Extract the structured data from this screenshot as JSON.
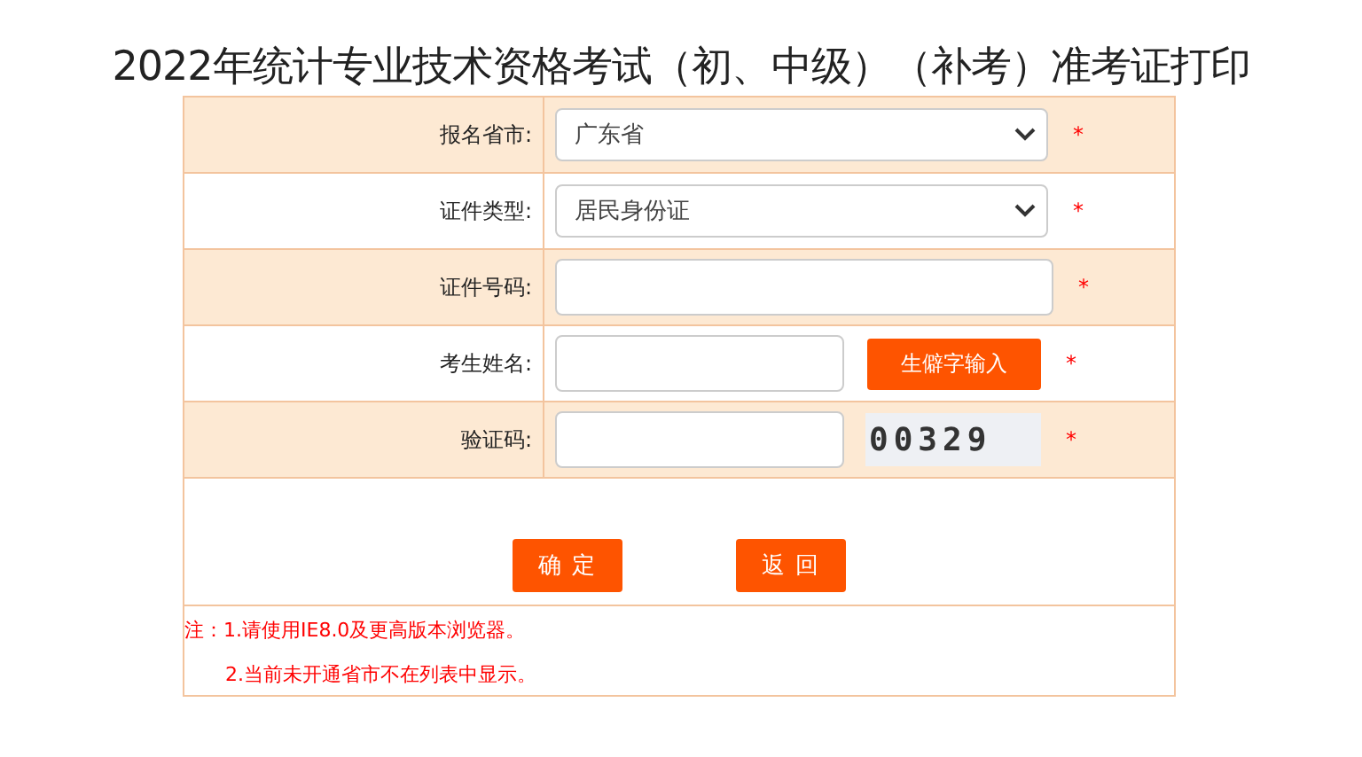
{
  "title": "2022年统计专业技术资格考试（初、中级）（补考）准考证打印",
  "rows": [
    {
      "label": "报名省市:",
      "kind": "select",
      "value": "广东省",
      "required": "*"
    },
    {
      "label": "证件类型:",
      "kind": "select",
      "value": "居民身份证",
      "required": "*"
    },
    {
      "label": "证件号码:",
      "kind": "input",
      "required": "*"
    },
    {
      "label": "考生姓名:",
      "kind": "input_button",
      "button": "生僻字输入",
      "required": "*"
    },
    {
      "label": "验证码:",
      "kind": "input_captcha",
      "captcha": "00329",
      "required": "*"
    }
  ],
  "buttons": [
    "确 定",
    "返 回"
  ],
  "notes": [
    "注：1.请使用IE8.0及更高版本浏览器。",
    "2.当前未开通省市不在列表中显示。"
  ]
}
